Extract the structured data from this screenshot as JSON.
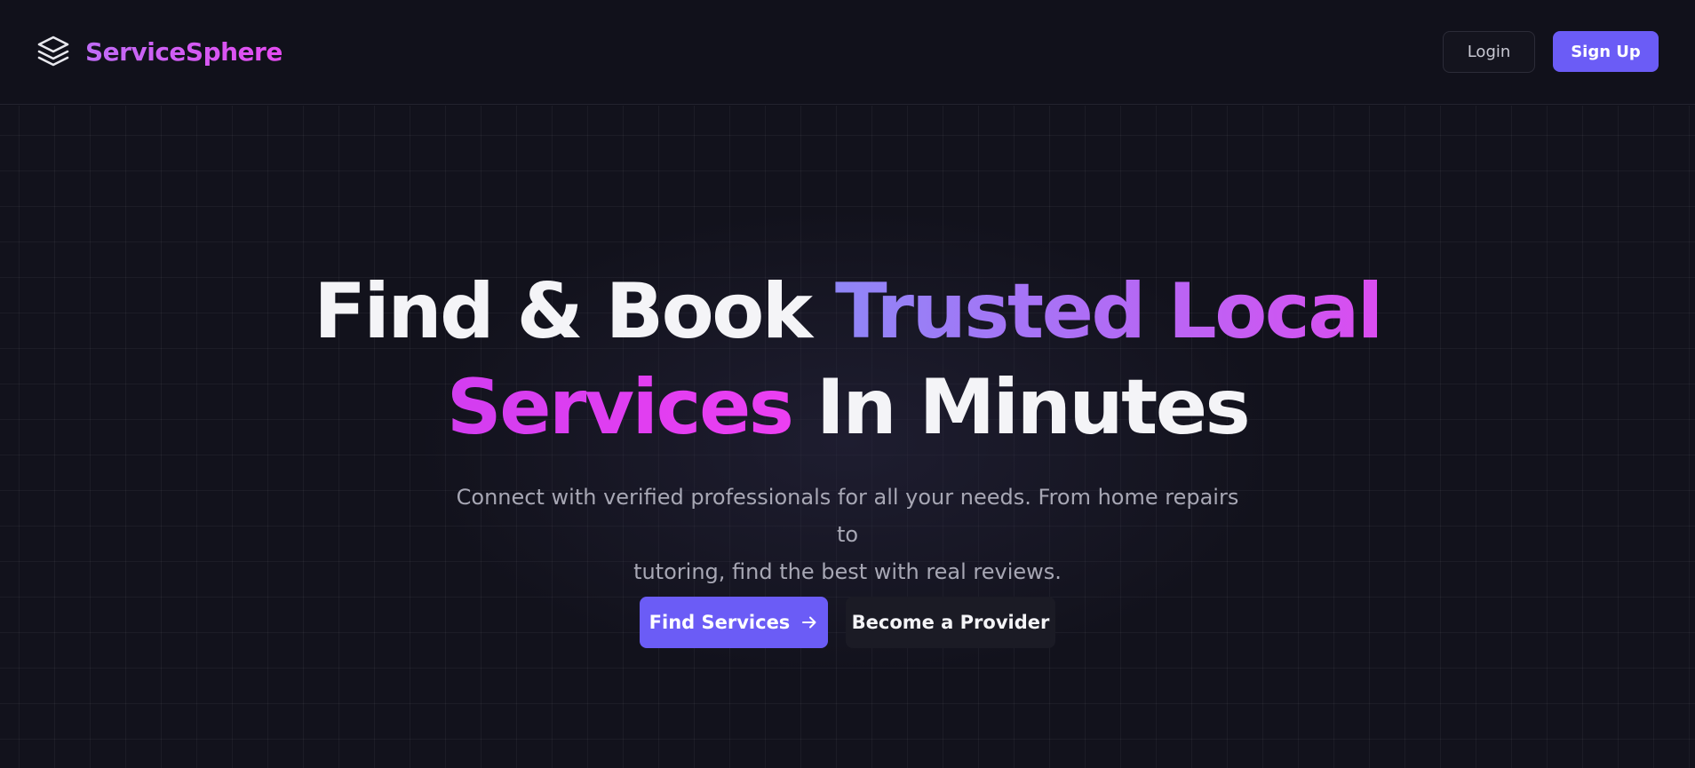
{
  "header": {
    "brand_name": "ServiceSphere",
    "brand_icon": "layers-icon",
    "login_label": "Login",
    "signup_label": "Sign Up"
  },
  "hero": {
    "headline": {
      "line1": {
        "white": "Find & Book ",
        "gradient": "Trusted Local"
      },
      "line2": {
        "gradient": "Services",
        "white": " In Minutes"
      }
    },
    "subtitle_line1": "Connect with verified professionals for all your needs. From home repairs to",
    "subtitle_line2": "tutoring, find the best with real reviews.",
    "primary_cta": {
      "label": "Find Services",
      "icon": "arrow-right-icon"
    },
    "secondary_cta": {
      "label": "Become a Provider"
    }
  },
  "colors": {
    "background": "#11111b",
    "accent": "#6b5cf6",
    "gradient_start": "#8f86f7",
    "gradient_end": "#ec3ff2",
    "text_muted": "#a7a7b4"
  }
}
